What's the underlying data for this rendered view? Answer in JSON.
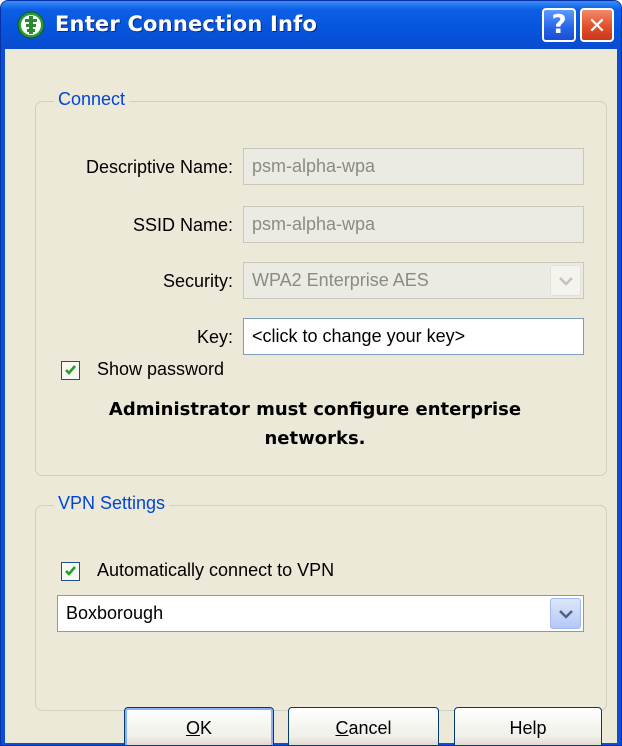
{
  "window": {
    "title": "Enter Connection Info",
    "help_glyph": "?",
    "close_glyph": "✕"
  },
  "connect": {
    "legend": "Connect",
    "descriptive_name": {
      "label": "Descriptive Name:",
      "value": "psm-alpha-wpa"
    },
    "ssid_name": {
      "label": "SSID Name:",
      "value": "psm-alpha-wpa"
    },
    "security": {
      "label": "Security:",
      "value": "WPA2 Enterprise AES"
    },
    "key": {
      "label": "Key:",
      "value": "<click to change your key>"
    },
    "show_password": {
      "label": "Show password",
      "checked": true
    },
    "notice": "Administrator must configure enterprise networks."
  },
  "vpn": {
    "legend": "VPN Settings",
    "auto_connect": {
      "label": "Automatically connect to VPN",
      "checked": true
    },
    "profile": "Boxborough"
  },
  "buttons": {
    "ok": {
      "mnemonic": "O",
      "rest": "K"
    },
    "cancel": {
      "mnemonic": "C",
      "rest": "ancel"
    },
    "help": "Help"
  },
  "colors": {
    "title_bar": "#0654dc",
    "dialog_bg": "#ece9d8",
    "legend_text": "#0046d5",
    "close_button": "#e2502a"
  }
}
